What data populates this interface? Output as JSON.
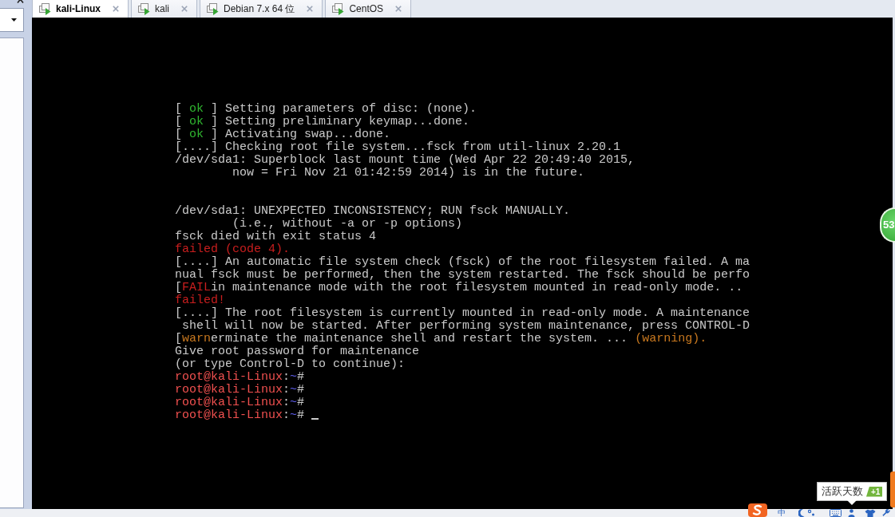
{
  "tabs": [
    {
      "label": "kali-Linux",
      "selected": true
    },
    {
      "label": "kali",
      "selected": false
    },
    {
      "label": "Debian 7.x 64 位",
      "selected": false
    },
    {
      "label": "CentOS",
      "selected": false
    }
  ],
  "console": {
    "blocks": [
      {
        "lines": [
          {
            "segments": [
              {
                "kind": "text",
                "text": "[ "
              },
              {
                "kind": "ok",
                "text": "ok"
              },
              {
                "kind": "text",
                "text": " ] Setting parameters of disc: (none)."
              }
            ]
          },
          {
            "segments": [
              {
                "kind": "text",
                "text": "[ "
              },
              {
                "kind": "ok",
                "text": "ok"
              },
              {
                "kind": "text",
                "text": " ] Setting preliminary keymap...done."
              }
            ]
          },
          {
            "segments": [
              {
                "kind": "text",
                "text": "[ "
              },
              {
                "kind": "ok",
                "text": "ok"
              },
              {
                "kind": "text",
                "text": " ] Activating swap...done."
              }
            ]
          },
          {
            "segments": [
              {
                "kind": "text",
                "text": "[....] Checking root file system...fsck from util-linux 2.20.1"
              }
            ]
          },
          {
            "segments": [
              {
                "kind": "text",
                "text": "/dev/sda1: Superblock last mount time (Wed Apr 22 20:49:40 2015,"
              }
            ]
          },
          {
            "segments": [
              {
                "kind": "text",
                "text": "        now = Fri Nov 21 01:42:59 2014) is in the future."
              }
            ]
          }
        ]
      },
      {
        "lines": [
          {
            "segments": [
              {
                "kind": "text",
                "text": "/dev/sda1: UNEXPECTED INCONSISTENCY; RUN fsck MANUALLY."
              }
            ]
          },
          {
            "segments": [
              {
                "kind": "text",
                "text": "        (i.e., without -a or -p options)"
              }
            ]
          },
          {
            "segments": [
              {
                "kind": "text",
                "text": "fsck died with exit status 4"
              }
            ]
          },
          {
            "segments": [
              {
                "kind": "fail",
                "text": "failed (code 4)."
              }
            ]
          },
          {
            "segments": [
              {
                "kind": "text",
                "text": "[....] An automatic file system check (fsck) of the root filesystem failed. A ma"
              }
            ]
          },
          {
            "segments": [
              {
                "kind": "text",
                "text": "nual fsck must be performed, then the system restarted. The fsck should be perfo"
              }
            ]
          },
          {
            "segments": [
              {
                "kind": "text",
                "text": "["
              },
              {
                "kind": "fail",
                "text": "FAIL"
              },
              {
                "kind": "text",
                "text": "in maintenance mode with the root filesystem mounted in read-only mode. .."
              }
            ]
          },
          {
            "segments": [
              {
                "kind": "fail",
                "text": "failed!"
              }
            ]
          },
          {
            "segments": [
              {
                "kind": "text",
                "text": "[....] The root filesystem is currently mounted in read-only mode. A maintenance"
              }
            ]
          },
          {
            "segments": [
              {
                "kind": "text",
                "text": " shell will now be started. After performing system maintenance, press CONTROL-D"
              }
            ]
          },
          {
            "segments": [
              {
                "kind": "text",
                "text": "["
              },
              {
                "kind": "warn",
                "text": "warn"
              },
              {
                "kind": "text",
                "text": "erminate the maintenance shell and restart the system. ... "
              },
              {
                "kind": "warn",
                "text": "(warning)."
              }
            ]
          },
          {
            "segments": [
              {
                "kind": "text",
                "text": "Give root password for maintenance"
              }
            ]
          },
          {
            "segments": [
              {
                "kind": "text",
                "text": "(or type Control-D to continue):"
              }
            ]
          },
          {
            "segments": [
              {
                "kind": "user",
                "text": "root@kali-Linux"
              },
              {
                "kind": "text",
                "text": ":"
              },
              {
                "kind": "path",
                "text": "~"
              },
              {
                "kind": "text",
                "text": "#"
              }
            ]
          },
          {
            "segments": [
              {
                "kind": "user",
                "text": "root@kali-Linux"
              },
              {
                "kind": "text",
                "text": ":"
              },
              {
                "kind": "path",
                "text": "~"
              },
              {
                "kind": "text",
                "text": "#"
              }
            ]
          },
          {
            "segments": [
              {
                "kind": "user",
                "text": "root@kali-Linux"
              },
              {
                "kind": "text",
                "text": ":"
              },
              {
                "kind": "path",
                "text": "~"
              },
              {
                "kind": "text",
                "text": "#"
              }
            ]
          },
          {
            "segments": [
              {
                "kind": "user",
                "text": "root@kali-Linux"
              },
              {
                "kind": "text",
                "text": ":"
              },
              {
                "kind": "path",
                "text": "~"
              },
              {
                "kind": "text",
                "text": "#"
              }
            ]
          }
        ]
      }
    ],
    "cursor": true
  },
  "floating_badge": {
    "count": "53"
  },
  "tooltip": {
    "text": "活跃天数",
    "badge": "+1"
  },
  "status_bar": {
    "input_mode": "中"
  }
}
